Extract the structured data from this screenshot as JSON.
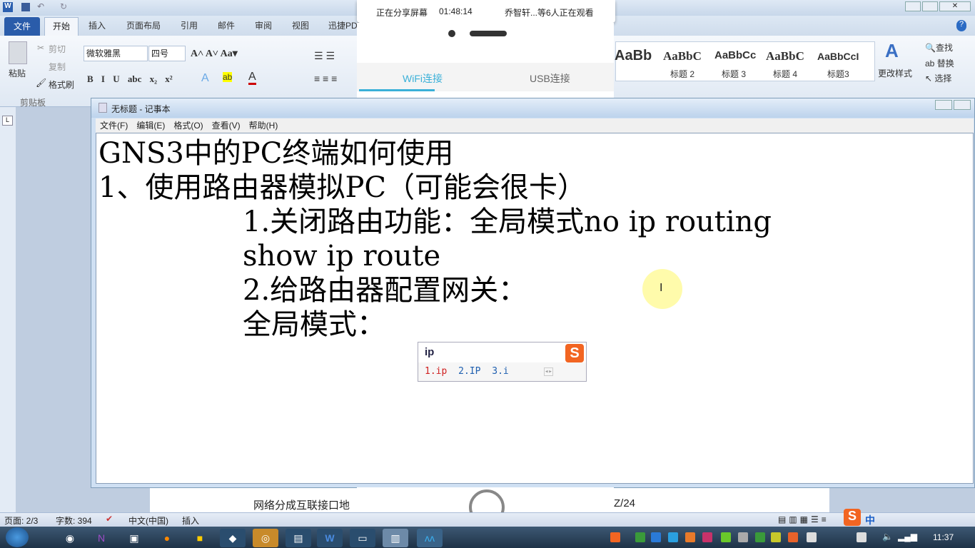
{
  "word": {
    "quick_access": [
      "W",
      "save",
      "undo",
      "redo"
    ],
    "tabs": [
      "文件",
      "开始",
      "插入",
      "页面布局",
      "引用",
      "邮件",
      "审阅",
      "视图",
      "迅捷PDF"
    ],
    "clipboard": {
      "paste": "粘贴",
      "cut": "剪切",
      "copy": "复制",
      "format_painter": "格式刷",
      "group": "剪贴板"
    },
    "font": {
      "name": "微软雅黑",
      "size": "四号"
    },
    "styles": [
      {
        "preview": "AaBb",
        "label": ""
      },
      {
        "preview": "AaBbC",
        "label": "标题 2"
      },
      {
        "preview": "AaBbCc",
        "label": "标题 3"
      },
      {
        "preview": "AaBbC",
        "label": "标题 4"
      },
      {
        "preview": "AaBbCcI",
        "label": "标题3"
      }
    ],
    "change_styles": "更改样式",
    "editing": {
      "find": "查找",
      "replace": "替换",
      "select": "选择"
    },
    "page_text": "网络分成互联接口地",
    "page_text_right": "Z/24",
    "status": {
      "page": "页面: 2/3",
      "words": "字数: 394",
      "language": "中文(中国)",
      "mode": "插入"
    }
  },
  "share": {
    "status": "正在分享屏幕",
    "time": "01:48:14",
    "viewers": "乔智轩...等6人正在观看",
    "tab_wifi": "WiFi连接",
    "tab_usb": "USB连接"
  },
  "notepad": {
    "title": "无标题 - 记事本",
    "menu": [
      "文件(F)",
      "编辑(E)",
      "格式(O)",
      "查看(V)",
      "帮助(H)"
    ],
    "lines": [
      "GNS3中的PC终端如何使用",
      "1、使用路由器模拟PC（可能会很卡）",
      "1.关闭路由功能：全局模式no ip routing",
      "show ip route",
      "2.给路由器配置网关：",
      "全局模式："
    ]
  },
  "ime": {
    "input": "ip",
    "candidates": [
      "1.ip",
      "2.IP",
      "3.i"
    ],
    "logo": "S"
  },
  "taskbar": {
    "clock": "11:37",
    "ime_tray": [
      "中"
    ]
  }
}
